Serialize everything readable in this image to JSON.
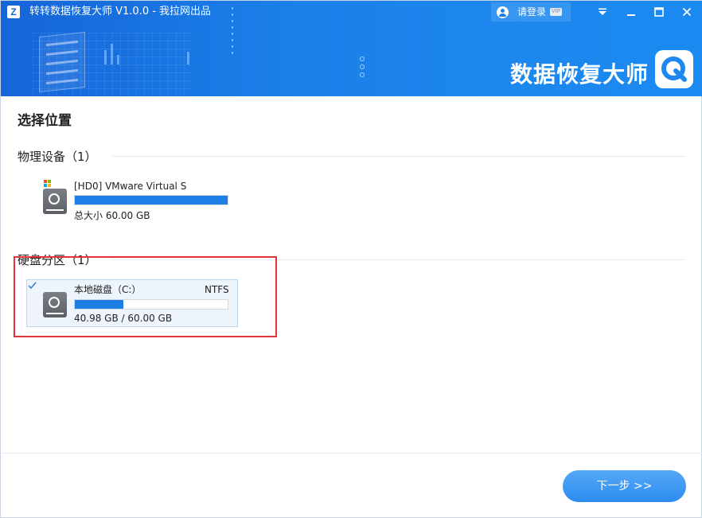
{
  "window": {
    "app_logo_letter": "Z",
    "title": "转转数据恢复大师 V1.0.0 - 我拉网出品",
    "login_label": "请登录",
    "vip_badge": "VIP",
    "brand_text": "数据恢复大师"
  },
  "colors": {
    "header_blue": "#1b7fe8",
    "progress_blue": "#1d7fe6",
    "highlight_red": "#e0333a",
    "selected_card_bg": "#edf4fc"
  },
  "icons": {
    "menu": "chevron-down-icon",
    "minimize": "minimize-icon",
    "maximize": "maximize-icon",
    "close": "close-icon",
    "user": "user-icon",
    "disk": "hard-disk-icon",
    "windows": "windows-logo-icon",
    "check": "checkmark-icon"
  },
  "main": {
    "section_title": "选择位置",
    "physical_devices": {
      "label": "物理设备（1）",
      "items": [
        {
          "name": "[HD0] VMware Virtual S",
          "usage_fraction": 1.0,
          "size_text": "总大小 60.00 GB"
        }
      ]
    },
    "partitions": {
      "label": "硬盘分区（1）",
      "items": [
        {
          "name": "本地磁盘（C:）",
          "filesystem": "NTFS",
          "used_gb": 40.98,
          "total_gb": 60.0,
          "usage_fraction": 0.32,
          "usage_text": "40.98 GB / 60.00 GB",
          "selected": true
        }
      ]
    }
  },
  "footer": {
    "next_button_label": "下一步 >>"
  }
}
